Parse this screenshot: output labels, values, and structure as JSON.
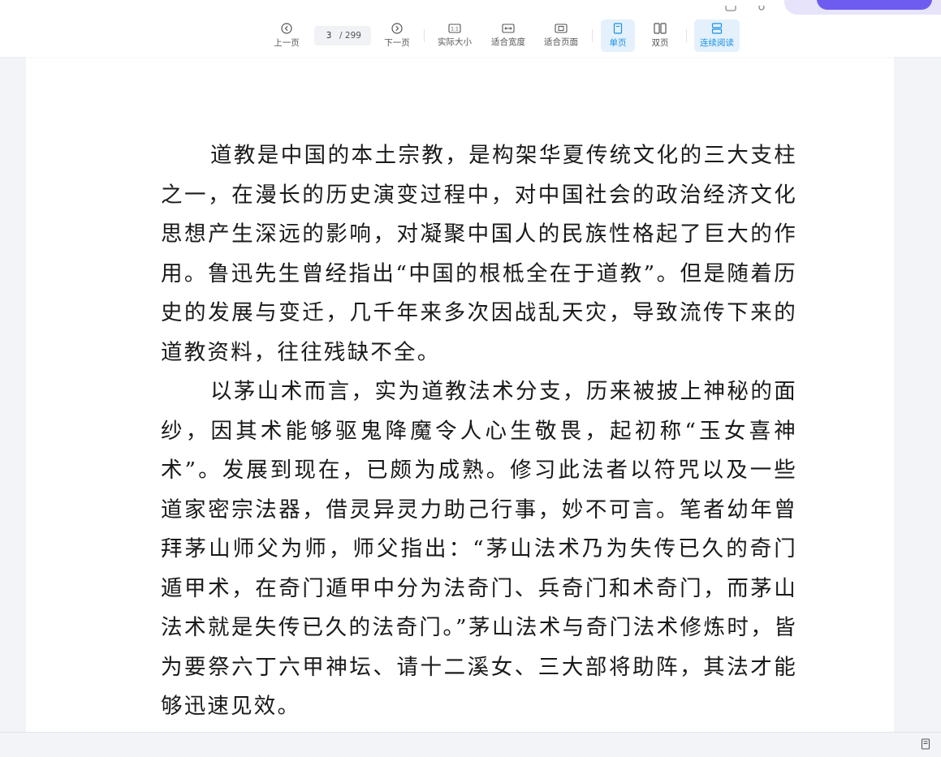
{
  "toolbar": {
    "prev_label": "上一页",
    "next_label": "下一页",
    "current_page": "3",
    "total_pages": "/ 299",
    "actual_size_label": "实际大小",
    "fit_width_label": "适合宽度",
    "fit_page_label": "适合页面",
    "single_page_label": "单页",
    "double_page_label": "双页",
    "continuous_label": "连续阅读",
    "active_view": "single_page",
    "continuous_active": true
  },
  "colors": {
    "accent": "#1a8fe6",
    "active_bg": "#e4f1fc",
    "ai_pill": "#6e5cf0"
  },
  "document": {
    "paragraphs": [
      "道教是中国的本土宗教，是构架华夏传统文化的三大支柱之一，在漫长的历史演变过程中，对中国社会的政治经济文化思想产生深远的影响，对凝聚中国人的民族性格起了巨大的作用。鲁迅先生曾经指出“中国的根柢全在于道教”。但是随着历史的发展与变迁，几千年来多次因战乱天灾，导致流传下来的道教资料，往往残缺不全。",
      "以茅山术而言，实为道教法术分支，历来被披上神秘的面纱，因其术能够驱鬼降魔令人心生敬畏，起初称“玉女喜神术”。发展到现在，已颇为成熟。修习此法者以符咒以及一些道家密宗法器，借灵异灵力助己行事，妙不可言。笔者幼年曾拜茅山师父为师，师父指出：“茅山法术乃为失传已久的奇门遁甲术，在奇门遁甲中分为法奇门、兵奇门和术奇门，而茅山法术就是失传已久的法奇门。”茅山法术与奇门法术修炼时，皆为要祭六丁六甲神坛、请十二溪女、三大部将助阵，其法才能够迅速见效。"
    ]
  }
}
